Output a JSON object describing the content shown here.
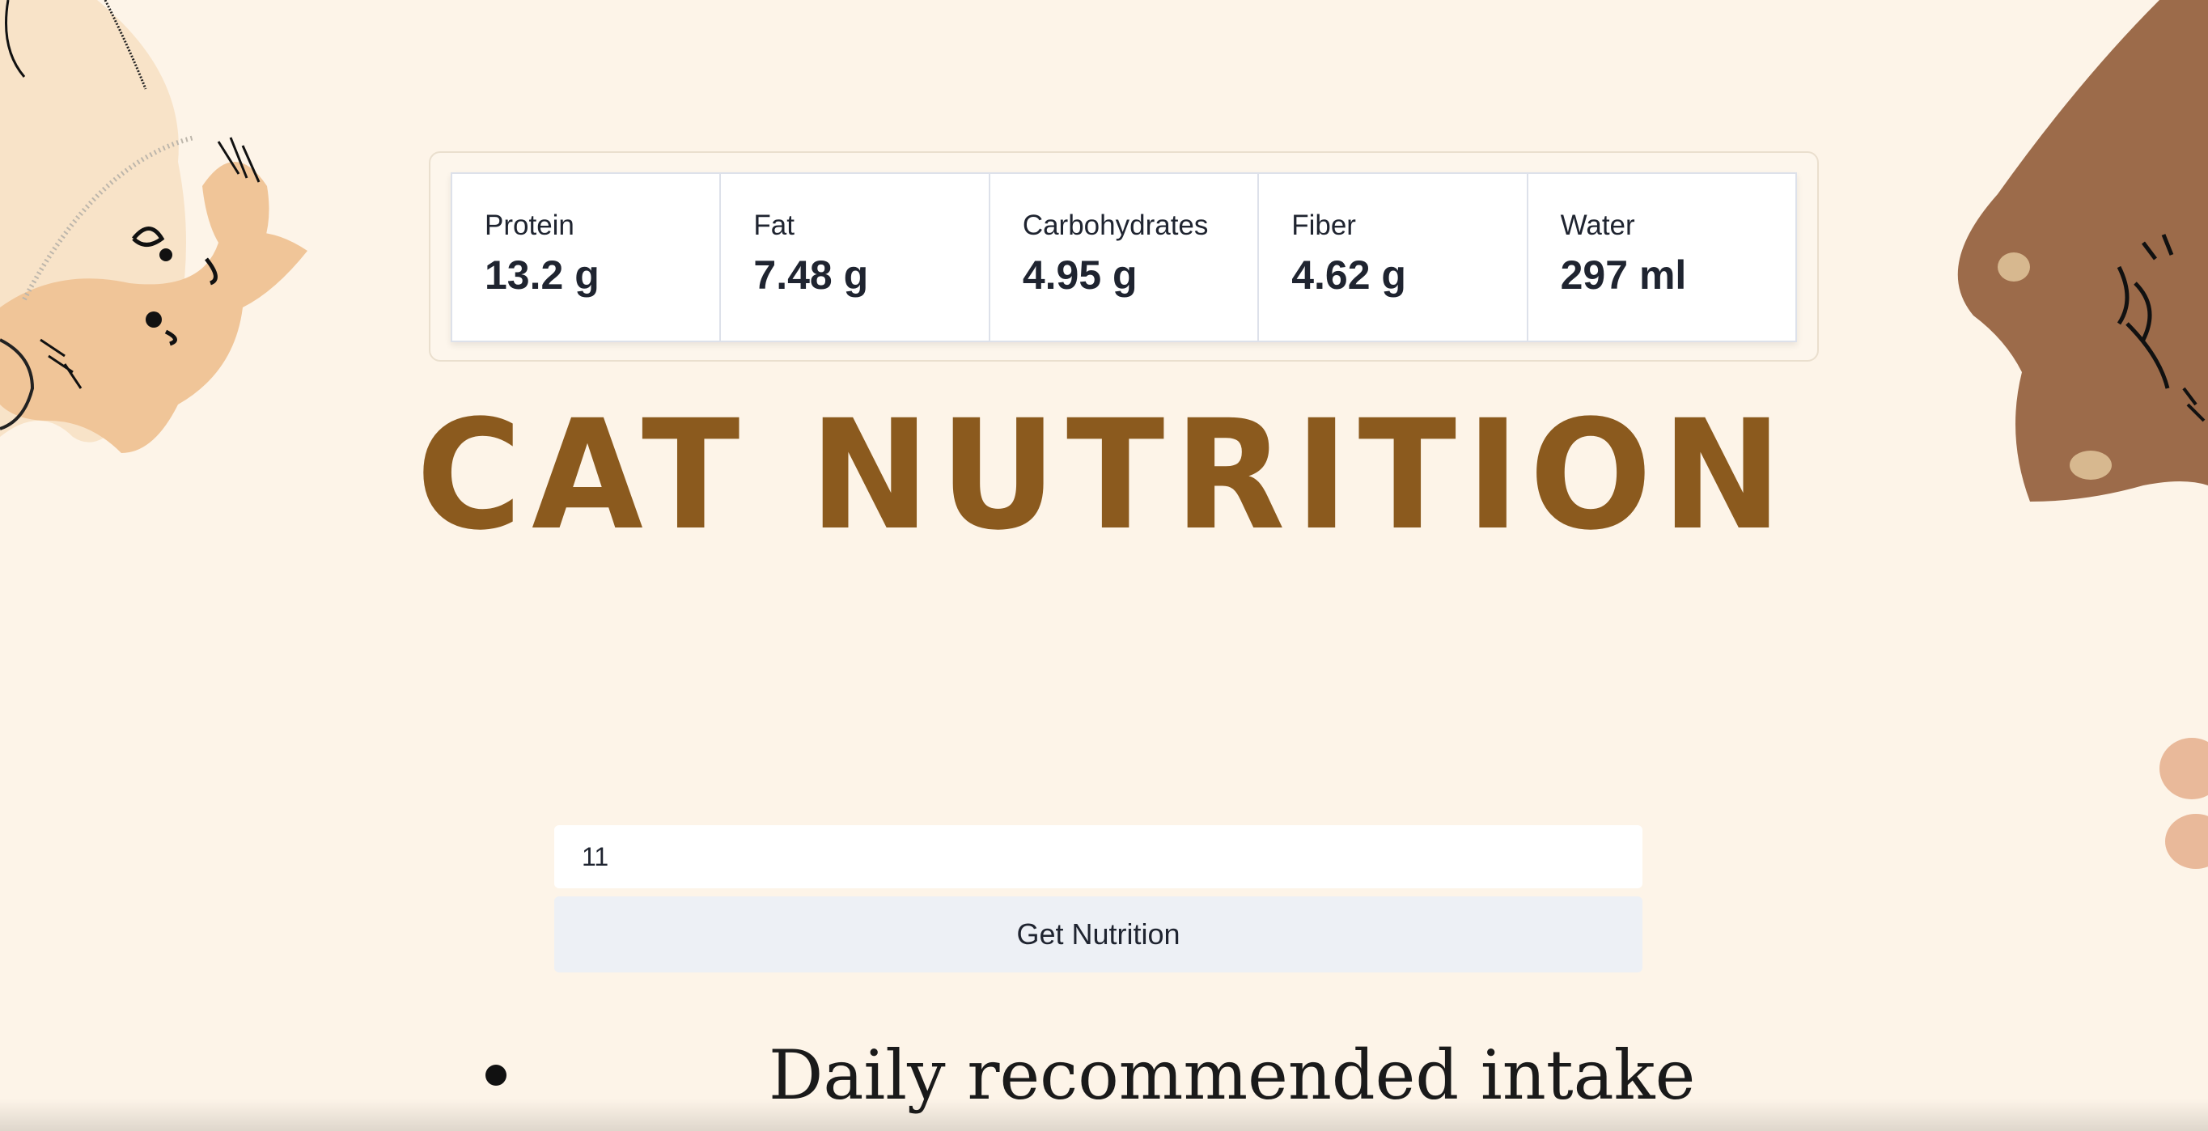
{
  "nutrition": [
    {
      "label": "Protein",
      "value": "13.2 g"
    },
    {
      "label": "Fat",
      "value": "7.48 g"
    },
    {
      "label": "Carbohydrates",
      "value": "4.95 g"
    },
    {
      "label": "Fiber",
      "value": "4.62 g"
    },
    {
      "label": "Water",
      "value": "297 ml"
    }
  ],
  "title": "CAT NUTRITION",
  "search": {
    "value": "11"
  },
  "button": {
    "label": "Get Nutrition"
  },
  "intake": {
    "label": "Daily recommended intake"
  },
  "colors": {
    "background": "#fdf4e8",
    "title": "#8b5a1e",
    "cat_light": "#f0c598",
    "cat_dark": "#9c6b4a"
  }
}
